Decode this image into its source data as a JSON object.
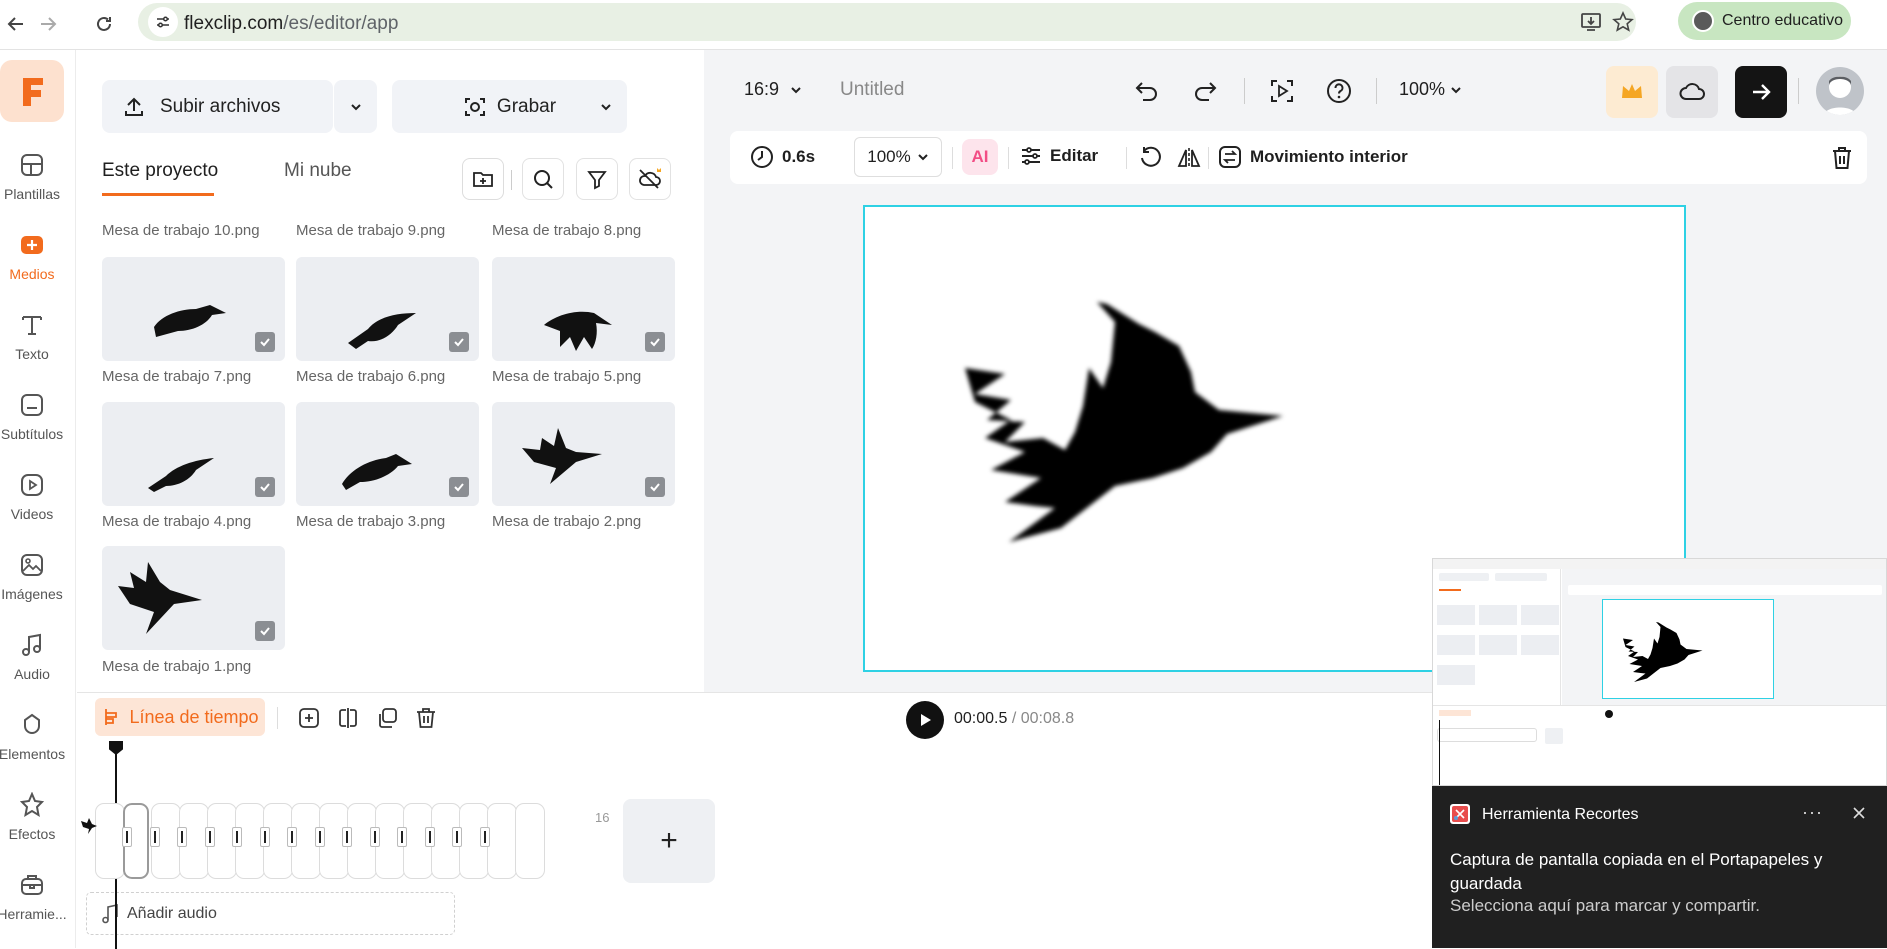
{
  "browser": {
    "url_host": "flexclip.com",
    "url_path": "/es/editor/app",
    "profile_label": "Centro educativo"
  },
  "rail": {
    "items": [
      {
        "label": "Plantillas",
        "icon": "templates-icon"
      },
      {
        "label": "Medios",
        "icon": "media-icon"
      },
      {
        "label": "Texto",
        "icon": "text-icon"
      },
      {
        "label": "Subtítulos",
        "icon": "subtitles-icon"
      },
      {
        "label": "Videos",
        "icon": "video-icon"
      },
      {
        "label": "Imágenes",
        "icon": "image-icon"
      },
      {
        "label": "Audio",
        "icon": "music-icon"
      },
      {
        "label": "Elementos",
        "icon": "shapes-icon"
      },
      {
        "label": "Efectos",
        "icon": "effects-icon"
      },
      {
        "label": "Herramie...",
        "icon": "toolbox-icon"
      }
    ],
    "active": "Medios"
  },
  "media": {
    "upload_label": "Subir archivos",
    "record_label": "Grabar",
    "tab_project": "Este proyecto",
    "tab_cloud": "Mi nube",
    "top_names": [
      "Mesa de trabajo 10.png",
      "Mesa de trabajo 9.png",
      "Mesa de trabajo 8.png"
    ],
    "files": [
      "Mesa de trabajo 7.png",
      "Mesa de trabajo 6.png",
      "Mesa de trabajo 5.png",
      "Mesa de trabajo 4.png",
      "Mesa de trabajo 3.png",
      "Mesa de trabajo 2.png",
      "Mesa de trabajo 1.png"
    ]
  },
  "editor": {
    "ratio": "16:9",
    "title": "Untitled",
    "zoom": "100%",
    "duration": "0.6s",
    "scale": "100%",
    "ai_label": "AI",
    "edit_label": "Editar",
    "motion_label": "Movimiento interior"
  },
  "timeline": {
    "label": "Línea de tiempo",
    "current": "00:00.5",
    "total": " / 00:08.8",
    "clip_count": "16",
    "add_clip": "+",
    "add_audio": "Añadir audio"
  },
  "toast": {
    "app": "Herramienta Recortes",
    "more": "···",
    "title": "Captura de pantalla copiada en el Portapapeles y guardada",
    "body": "Selecciona aquí para marcar y compartir."
  },
  "colors": {
    "accent": "#f26b1d",
    "canvas_border": "#2ed1e4",
    "toast_bg": "#202020"
  }
}
